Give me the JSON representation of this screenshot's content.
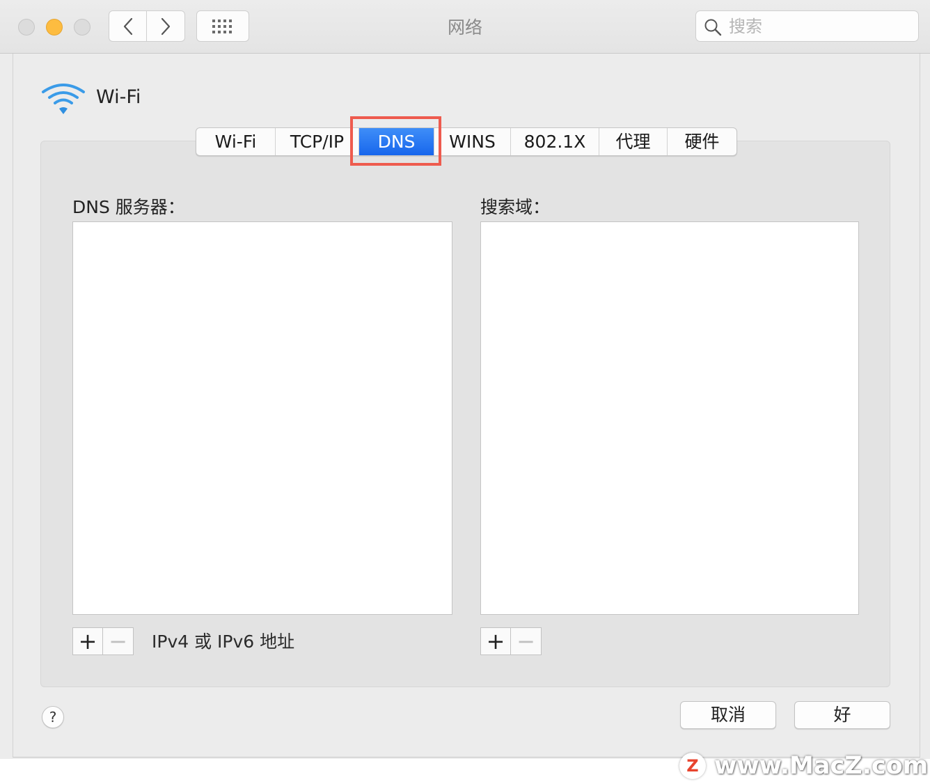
{
  "window": {
    "title": "网络",
    "search_placeholder": "搜索"
  },
  "network": {
    "interface_name": "Wi-Fi"
  },
  "tabs": [
    {
      "label": "Wi-Fi",
      "active": false
    },
    {
      "label": "TCP/IP",
      "active": false
    },
    {
      "label": "DNS",
      "active": true
    },
    {
      "label": "WINS",
      "active": false
    },
    {
      "label": "802.1X",
      "active": false
    },
    {
      "label": "代理",
      "active": false
    },
    {
      "label": "硬件",
      "active": false
    }
  ],
  "dns": {
    "servers_label": "DNS 服务器：",
    "servers": [],
    "servers_hint": "IPv4 或 IPv6 地址",
    "search_domains_label": "搜索域：",
    "search_domains": []
  },
  "controls": {
    "plus": "+",
    "minus": "−",
    "help": "?"
  },
  "buttons": {
    "cancel": "取消",
    "ok": "好"
  },
  "watermark": {
    "logo_letter": "Z",
    "text": "www.MacZ.com"
  },
  "colors": {
    "accent": "#1766ec",
    "highlight_box": "#ee5b4e",
    "traffic_yellow": "#fdbc40"
  }
}
